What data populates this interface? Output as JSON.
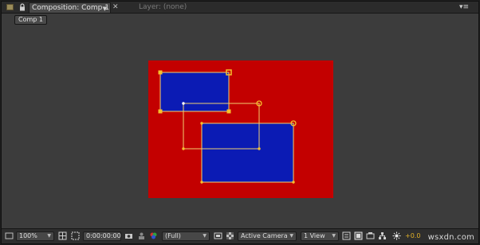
{
  "panel": {
    "tab_title": "Composition: Comp 1",
    "tab_inactive": "Layer: (none)",
    "comp_chip": "Comp 1"
  },
  "canvas": {
    "background_color": "#c30000",
    "layer_color": "#0b1bb4",
    "handle_color": "#f6c12c",
    "layers": [
      "upper-left blue solid",
      "lower-right blue solid",
      "empty transform box"
    ]
  },
  "footer": {
    "zoom": "100%",
    "timecode": "0:00:00:00",
    "resolution": "(Full)",
    "camera": "Active Camera",
    "views": "1 View",
    "exposure": "+0.0"
  },
  "watermark": "wsxdn.com",
  "colors": {
    "panel_bg": "#3c3c3c",
    "bar_bg": "#2e2e2e",
    "accent": "#e1b128"
  }
}
